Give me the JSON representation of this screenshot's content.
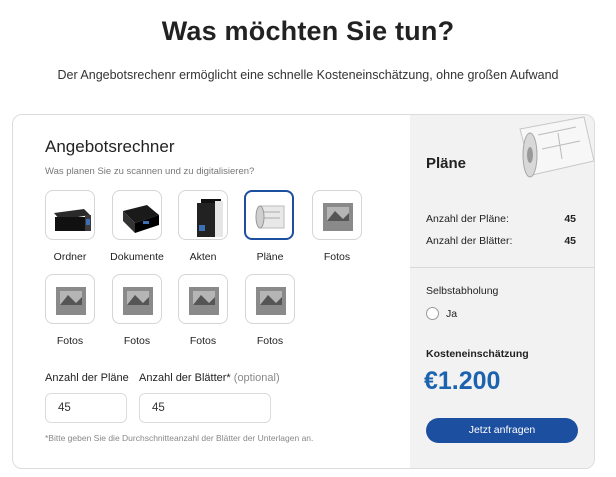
{
  "page": {
    "headline": "Was möchten Sie tun?",
    "subline": "Der Angebotsrechenr ermöglicht eine schnelle Kosteneinschätzung, ohne großen Aufwand"
  },
  "calculator": {
    "title": "Angebotsrechner",
    "question": "Was planen Sie zu scannen und zu digitalisieren?",
    "options": [
      {
        "label": "Ordner",
        "icon": "binder-icon",
        "selected": false
      },
      {
        "label": "Dokumente",
        "icon": "document-stack-icon",
        "selected": false
      },
      {
        "label": "Akten",
        "icon": "folder-icon",
        "selected": false
      },
      {
        "label": "Pläne",
        "icon": "plan-roll-icon",
        "selected": true
      },
      {
        "label": "Fotos",
        "icon": "photo-icon",
        "selected": false
      },
      {
        "label": "Fotos",
        "icon": "photo-icon",
        "selected": false
      },
      {
        "label": "Fotos",
        "icon": "photo-icon",
        "selected": false
      },
      {
        "label": "Fotos",
        "icon": "photo-icon",
        "selected": false
      },
      {
        "label": "Fotos",
        "icon": "photo-icon",
        "selected": false
      }
    ],
    "plans_label": "Anzahl der Pläne",
    "plans_value": "45",
    "sheets_label": "Anzahl der Blätter*",
    "sheets_optional": "(optional)",
    "sheets_value": "45",
    "hint": "*Bitte geben Sie die Durchschnitteanzahl der Blätter der Unterlagen an."
  },
  "summary": {
    "title": "Pläne",
    "plans_label": "Anzahl der Pläne:",
    "plans_value": "45",
    "sheets_label": "Anzahl der Blätter:",
    "sheets_value": "45",
    "pickup_label": "Selbstabholung",
    "pickup_option": "Ja",
    "estimate_label": "Kosteneinschätzung",
    "price": "€1.200",
    "cta": "Jetzt anfragen"
  },
  "colors": {
    "accent": "#1d4fa0",
    "price": "#1b63ae",
    "summary_bg": "#f2f2f2"
  }
}
